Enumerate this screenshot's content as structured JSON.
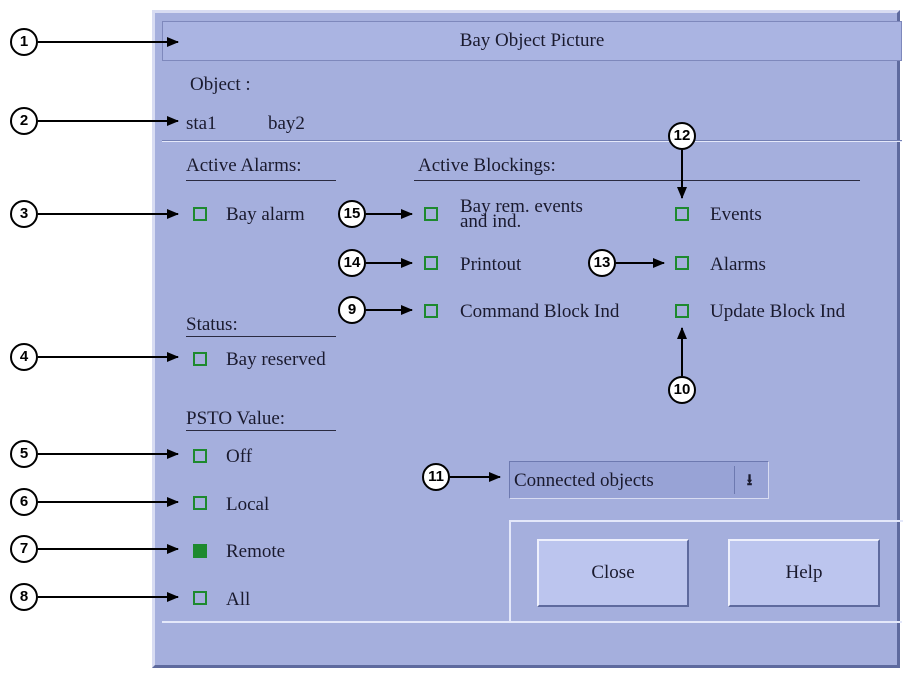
{
  "dialog": {
    "title": "Bay Object Picture",
    "object_label": "Object :",
    "object_station": "sta1",
    "object_bay": "bay2"
  },
  "alarms": {
    "heading": "Active Alarms:",
    "bay_alarm": {
      "label": "Bay alarm",
      "checked": false
    }
  },
  "blockings": {
    "heading": "Active Blockings:",
    "bay_rem_events_line1": "Bay rem. events",
    "bay_rem_events_line2": "and ind.",
    "printout": "Printout",
    "command_block": "Command Block Ind",
    "events": "Events",
    "alarms": "Alarms",
    "update_block": "Update Block Ind"
  },
  "status": {
    "heading": "Status:",
    "bay_reserved": "Bay reserved"
  },
  "psto": {
    "heading": "PSTO Value:",
    "options": [
      {
        "label": "Off",
        "checked": false
      },
      {
        "label": "Local",
        "checked": false
      },
      {
        "label": "Remote",
        "checked": true
      },
      {
        "label": "All",
        "checked": false
      }
    ]
  },
  "connected_objects": {
    "value": "Connected objects",
    "icon": "arrow-down-icon"
  },
  "buttons": {
    "close": "Close",
    "help": "Help"
  },
  "callouts": [
    "1",
    "2",
    "3",
    "4",
    "5",
    "6",
    "7",
    "8",
    "9",
    "10",
    "11",
    "12",
    "13",
    "14",
    "15"
  ],
  "colors": {
    "dialog_bg": "#a5afdd",
    "checkbox_green": "#1d8a2e",
    "button_bg": "#bcc5ee"
  }
}
